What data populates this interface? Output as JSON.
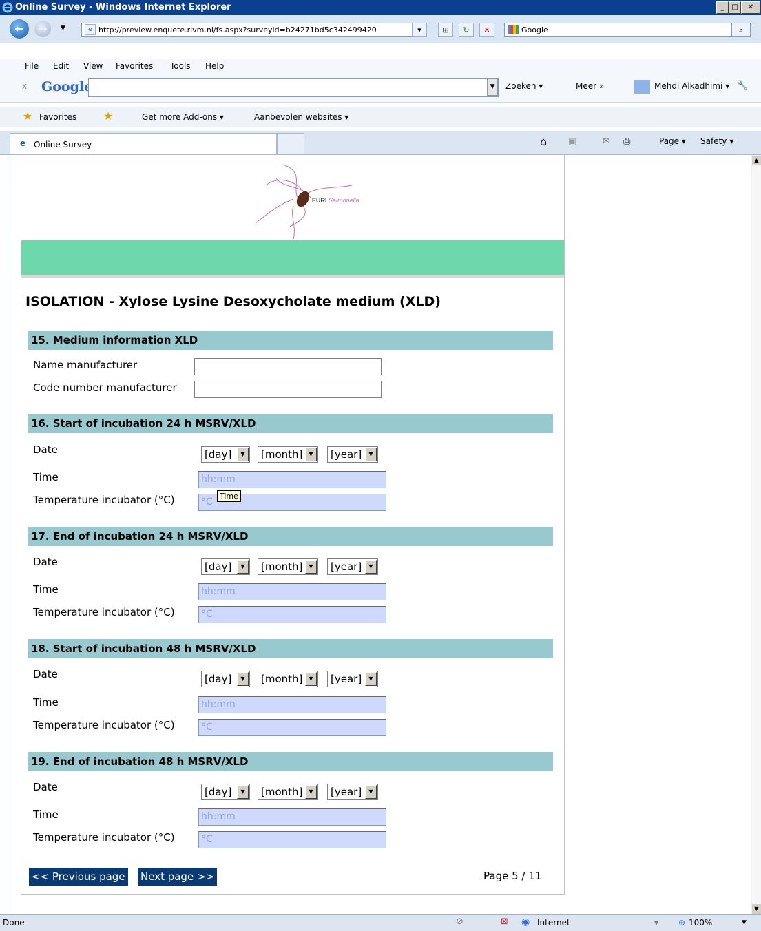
{
  "window": {
    "title": "Online Survey - Windows Internet Explorer"
  },
  "address": {
    "url": "http://preview.enquete.rivm.nl/fs.aspx?surveyid=b24271bd5c342499420",
    "search_placeholder": "Google"
  },
  "menu": {
    "items": [
      "File",
      "Edit",
      "View",
      "Favorites",
      "Tools",
      "Help"
    ]
  },
  "googlebar": {
    "brand": "Google",
    "zoeken": "Zoeken ▾",
    "meer": "Meer »",
    "user": "Mehdi Alkadhimi ▾"
  },
  "favorites": {
    "favorites": "Favorites",
    "addons": "Get more Add-ons ▾",
    "recommended": "Aanbevolen websites ▾"
  },
  "tab": {
    "title": "Online Survey"
  },
  "commandbar": {
    "page": "Page ▾",
    "safety": "Safety ▾"
  },
  "survey": {
    "logo_text_bold": "EURL",
    "logo_text_italic": "Salmonella",
    "title": "ISOLATION - Xylose Lysine Desoxycholate medium (XLD)",
    "section15": {
      "heading": "15. Medium information XLD",
      "name_label": "Name manufacturer",
      "code_label": "Code number manufacturer"
    },
    "sections": [
      {
        "heading": "16. Start of incubation 24 h MSRV/XLD"
      },
      {
        "heading": "17. End of incubation 24 h MSRV/XLD"
      },
      {
        "heading": "18. Start of incubation 48 h MSRV/XLD"
      },
      {
        "heading": "19. End of incubation 48 h MSRV/XLD"
      }
    ],
    "labels": {
      "date": "Date",
      "time": "Time",
      "temp": "Temperature incubator (°C)"
    },
    "selects": {
      "day": "[day]",
      "month": "[month]",
      "year": "[year]"
    },
    "placeholders": {
      "time": "hh:mm",
      "temp": "°C"
    },
    "tooltip": "Time",
    "prev_button": "<< Previous page",
    "next_button": "Next page >>",
    "page_indicator": "Page 5 / 11"
  },
  "status": {
    "left": "Done",
    "zone": "Internet",
    "zoom": "100%"
  }
}
